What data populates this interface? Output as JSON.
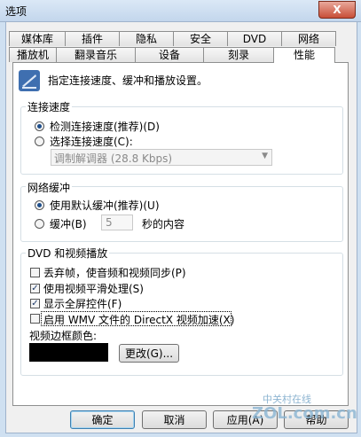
{
  "window": {
    "title": "选项",
    "close_label": "X"
  },
  "tabs_top": [
    "媒体库",
    "插件",
    "隐私",
    "安全",
    "DVD",
    "网络"
  ],
  "tabs_bottom": [
    "播放机",
    "翻录音乐",
    "设备",
    "刻录",
    "性能"
  ],
  "header": {
    "text": "指定连接速度、缓冲和播放设置。",
    "icon": "performance-icon"
  },
  "connection": {
    "title": "连接速度",
    "detect_label": "检测连接速度(推荐)(D)",
    "choose_label": "选择连接速度(C):",
    "dropdown_value": "调制解调器 (28.8 Kbps)"
  },
  "buffering": {
    "title": "网络缓冲",
    "default_label": "使用默认缓冲(推荐)(U)",
    "buffer_label": "缓冲(B)",
    "buffer_value": "5",
    "seconds_label": "秒的内容"
  },
  "dvd_video": {
    "title": "DVD 和视频播放",
    "drop_frames_label": "丢弃帧，使音频和视频同步(P)",
    "smoothing_label": "使用视频平滑处理(S)",
    "fullscreen_controls_label": "显示全屏控件(F)",
    "directx_label": "启用 WMV 文件的 DirectX 视频加速(X)",
    "border_color_label": "视频边框颜色:",
    "change_button": "更改(G)..."
  },
  "footer": {
    "ok": "确定",
    "cancel": "取消",
    "apply": "应用(A)",
    "help": "帮助"
  },
  "watermark": {
    "line1": "中关村在线",
    "line2": "ZOL.com.cn"
  },
  "colors": {
    "accent": "#1f4f8b",
    "swatch": "#000000"
  }
}
